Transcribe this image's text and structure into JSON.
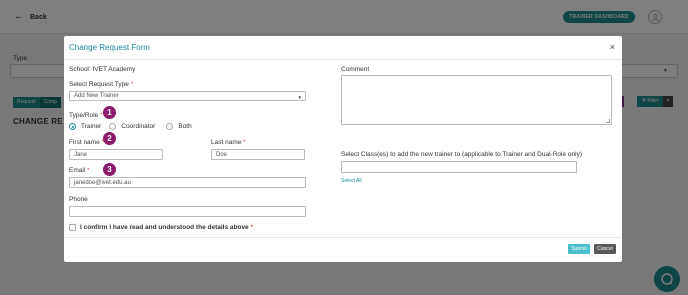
{
  "background": {
    "back_label": "Back",
    "trainer_dashboard_label": "TRAINER DASHBOARD",
    "type_label": "Type",
    "tab1_label": "Request",
    "tab2_label": "Comp",
    "filter_label": "Filter",
    "filter_clear": "×",
    "heading": "CHANGE RE"
  },
  "modal": {
    "title": "Change Request Form",
    "close": "×",
    "school": "School: IVET Academy",
    "request_type_label": "Select Request Type",
    "request_type_value": "Add New Trainer",
    "type_role_label": "Type/Role",
    "roles": [
      {
        "label": "Trainer",
        "checked": true
      },
      {
        "label": "Coordinator",
        "checked": false
      },
      {
        "label": "Both",
        "checked": false
      }
    ],
    "first_name_label": "First name",
    "first_name_value": "Jane",
    "last_name_label": "Last name",
    "last_name_value": "Doe",
    "email_label": "Email",
    "email_value": "janedoe@ivet.edu.au",
    "phone_label": "Phone",
    "phone_value": "",
    "comment_label": "Comment",
    "class_label": "Select Class(es) to add the new trainer to (applicable to Trainer and Dual-Role only)",
    "select_all": "Select All",
    "confirm_label": "I confirm I have read and understood the details above",
    "required_marker": "*",
    "submit": "Submit",
    "cancel": "Cancel"
  },
  "badges": [
    "1",
    "2",
    "3"
  ],
  "colors": {
    "accent": "#1d8a9a",
    "badge": "#8a1a6b",
    "submit": "#4bbfc9",
    "cancel": "#5a5a5a"
  }
}
